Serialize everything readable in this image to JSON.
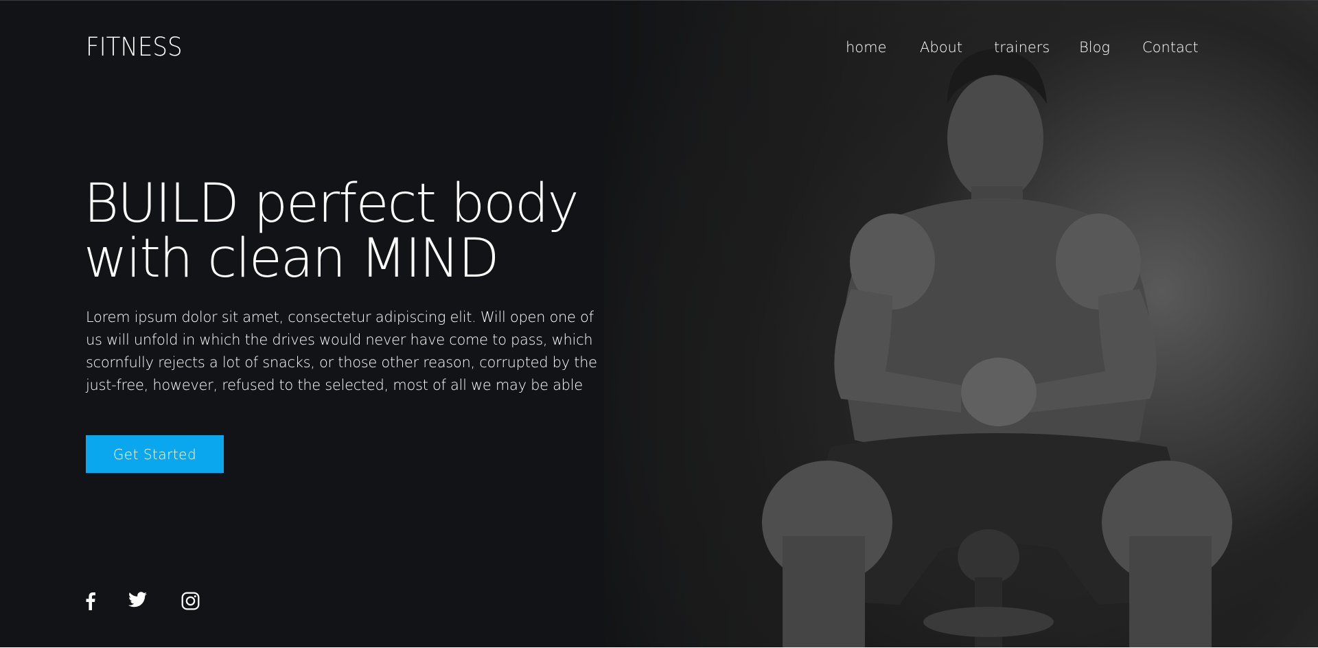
{
  "brand": {
    "name": "FITNESS"
  },
  "nav": {
    "items": [
      {
        "label": "home"
      },
      {
        "label": "About"
      },
      {
        "label": "trainers"
      },
      {
        "label": "Blog"
      },
      {
        "label": "Contact"
      }
    ]
  },
  "hero": {
    "headline_line1": "BUILD perfect body",
    "headline_line2": "with clean MIND",
    "description": "Lorem ipsum dolor sit amet, consectetur adipiscing elit. Will open one of us will unfold in which the drives would never have come to pass, which scornfully rejects a lot of snacks, or those other reason, corrupted by the just-free, however, refused to the selected, most of all we may be able",
    "cta_label": "Get Started",
    "cta_color": "#0aa7ee",
    "background_color": "#121316",
    "photo": "muscular-man-sitting-grayscale-photo"
  },
  "social": {
    "icons": [
      "facebook-icon",
      "twitter-icon",
      "instagram-icon"
    ]
  }
}
